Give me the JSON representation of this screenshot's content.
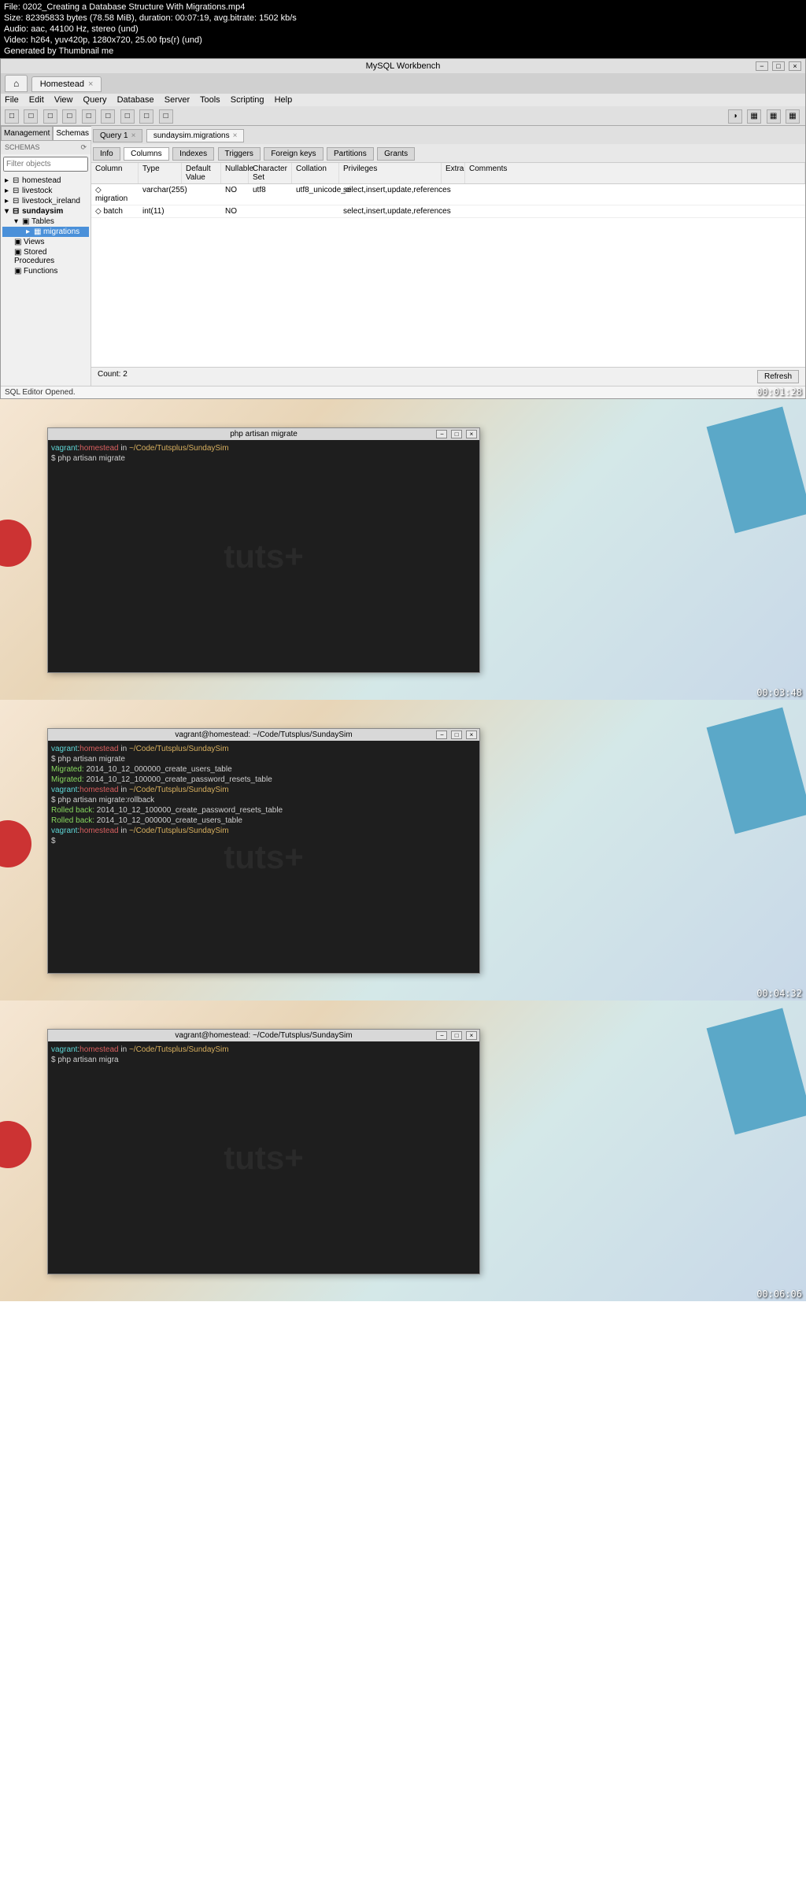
{
  "fileinfo": {
    "file": "File: 0202_Creating a Database Structure With Migrations.mp4",
    "size": "Size: 82395833 bytes (78.58 MiB), duration: 00:07:19, avg.bitrate: 1502 kb/s",
    "audio": "Audio: aac, 44100 Hz, stereo (und)",
    "video": "Video: h264, yuv420p, 1280x720, 25.00 fps(r) (und)",
    "gen": "Generated by Thumbnail me"
  },
  "workbench": {
    "title": "MySQL Workbench",
    "tab_label": "Homestead",
    "menu": [
      "File",
      "Edit",
      "View",
      "Query",
      "Database",
      "Server",
      "Tools",
      "Scripting",
      "Help"
    ],
    "side_tabs": [
      "Management",
      "Schemas"
    ],
    "schemas_label": "SCHEMAS",
    "filter_placeholder": "Filter objects",
    "tree": {
      "homestead": "homestead",
      "livestock": "livestock",
      "livestock_ireland": "livestock_ireland",
      "sundaysim": "sundaysim",
      "tables": "Tables",
      "migrations": "migrations",
      "views": "Views",
      "stored": "Stored Procedures",
      "functions": "Functions"
    },
    "main_tabs": {
      "query1": "Query 1",
      "migrations": "sundaysim.migrations"
    },
    "sub_tabs": [
      "Info",
      "Columns",
      "Indexes",
      "Triggers",
      "Foreign keys",
      "Partitions",
      "Grants"
    ],
    "table_headers": [
      "Column",
      "Type",
      "Default Value",
      "Nullable",
      "Character Set",
      "Collation",
      "Privileges",
      "Extra",
      "Comments"
    ],
    "rows": [
      {
        "col": "migration",
        "type": "varchar(255)",
        "null": "NO",
        "charset": "utf8",
        "collation": "utf8_unicode_ci",
        "priv": "select,insert,update,references"
      },
      {
        "col": "batch",
        "type": "int(11)",
        "null": "NO",
        "charset": "",
        "collation": "",
        "priv": "select,insert,update,references"
      }
    ],
    "count": "Count: 2",
    "refresh": "Refresh",
    "status": "SQL Editor Opened."
  },
  "timestamps": [
    "00:01:28",
    "00:03:48",
    "00:04:32",
    "00:06:06"
  ],
  "terminals": [
    {
      "title": "php artisan migrate",
      "lines": [
        {
          "parts": [
            {
              "c": "cyan",
              "t": "vagrant"
            },
            {
              "c": "white",
              "t": ":"
            },
            {
              "c": "red",
              "t": "homestead"
            },
            {
              "c": "white",
              "t": " in "
            },
            {
              "c": "yellow",
              "t": "~/Code/Tutsplus/SundaySim"
            }
          ]
        },
        {
          "parts": [
            {
              "c": "white",
              "t": "$ php artisan migrate"
            }
          ]
        }
      ]
    },
    {
      "title": "vagrant@homestead: ~/Code/Tutsplus/SundaySim",
      "lines": [
        {
          "parts": [
            {
              "c": "cyan",
              "t": "vagrant"
            },
            {
              "c": "white",
              "t": ":"
            },
            {
              "c": "red",
              "t": "homestead"
            },
            {
              "c": "white",
              "t": " in "
            },
            {
              "c": "yellow",
              "t": "~/Code/Tutsplus/SundaySim"
            }
          ]
        },
        {
          "parts": [
            {
              "c": "white",
              "t": "$ php artisan migrate"
            }
          ]
        },
        {
          "parts": [
            {
              "c": "green",
              "t": "Migrated:"
            },
            {
              "c": "white",
              "t": " 2014_10_12_000000_create_users_table"
            }
          ]
        },
        {
          "parts": [
            {
              "c": "green",
              "t": "Migrated:"
            },
            {
              "c": "white",
              "t": " 2014_10_12_100000_create_password_resets_table"
            }
          ]
        },
        {
          "parts": [
            {
              "c": "cyan",
              "t": "vagrant"
            },
            {
              "c": "white",
              "t": ":"
            },
            {
              "c": "red",
              "t": "homestead"
            },
            {
              "c": "white",
              "t": " in "
            },
            {
              "c": "yellow",
              "t": "~/Code/Tutsplus/SundaySim"
            }
          ]
        },
        {
          "parts": [
            {
              "c": "white",
              "t": "$ php artisan migrate:rollback"
            }
          ]
        },
        {
          "parts": [
            {
              "c": "green",
              "t": "Rolled back:"
            },
            {
              "c": "white",
              "t": " 2014_10_12_100000_create_password_resets_table"
            }
          ]
        },
        {
          "parts": [
            {
              "c": "green",
              "t": "Rolled back:"
            },
            {
              "c": "white",
              "t": " 2014_10_12_000000_create_users_table"
            }
          ]
        },
        {
          "parts": [
            {
              "c": "cyan",
              "t": "vagrant"
            },
            {
              "c": "white",
              "t": ":"
            },
            {
              "c": "red",
              "t": "homestead"
            },
            {
              "c": "white",
              "t": " in "
            },
            {
              "c": "yellow",
              "t": "~/Code/Tutsplus/SundaySim"
            }
          ]
        },
        {
          "parts": [
            {
              "c": "white",
              "t": "$"
            }
          ]
        }
      ]
    },
    {
      "title": "vagrant@homestead: ~/Code/Tutsplus/SundaySim",
      "lines": [
        {
          "parts": [
            {
              "c": "cyan",
              "t": "vagrant"
            },
            {
              "c": "white",
              "t": ":"
            },
            {
              "c": "red",
              "t": "homestead"
            },
            {
              "c": "white",
              "t": " in "
            },
            {
              "c": "yellow",
              "t": "~/Code/Tutsplus/SundaySim"
            }
          ]
        },
        {
          "parts": [
            {
              "c": "white",
              "t": "$ php artisan migra"
            }
          ]
        }
      ]
    }
  ],
  "watermark": "tuts+"
}
